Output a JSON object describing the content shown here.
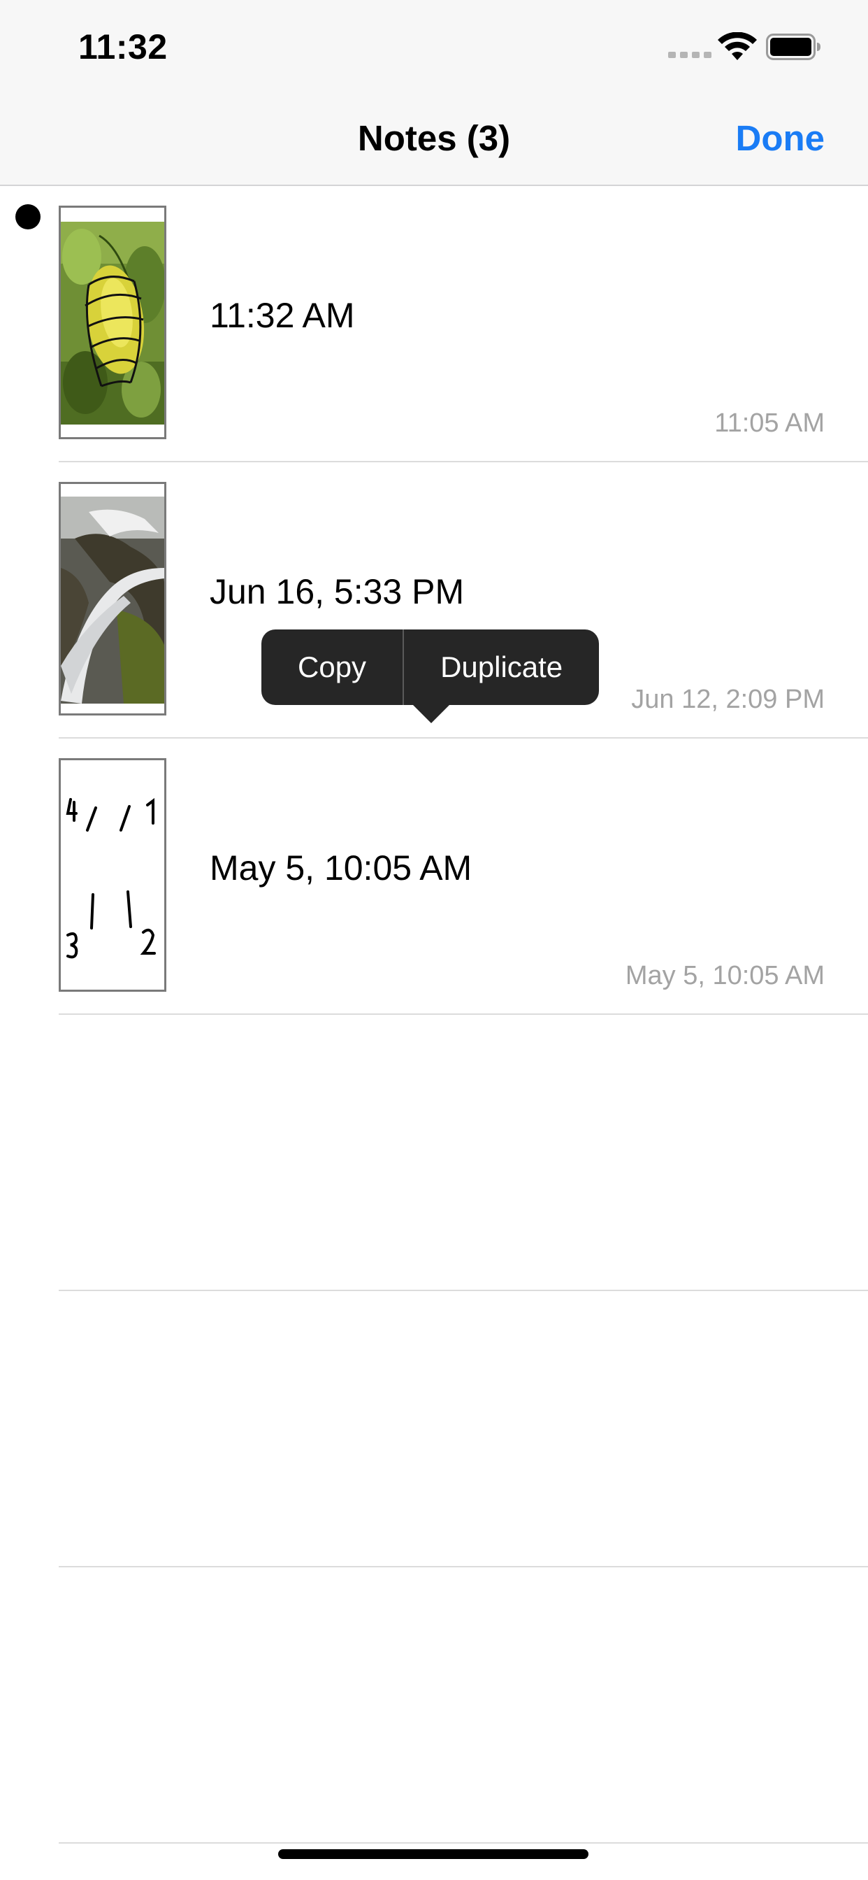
{
  "status_bar": {
    "time": "11:32"
  },
  "nav": {
    "title": "Notes (3)",
    "done_label": "Done"
  },
  "notes": [
    {
      "title": "11:32 AM",
      "date": "11:05 AM",
      "thumbnail": "leaf-photo-with-drawing",
      "selected": true
    },
    {
      "title": "Jun 16, 5:33 PM",
      "date": "Jun 12, 2:09 PM",
      "thumbnail": "waterfall-photo",
      "selected": false
    },
    {
      "title": "May 5, 10:05 AM",
      "date": "May 5, 10:05 AM",
      "thumbnail": "handwritten-marks-sketch",
      "selected": false
    }
  ],
  "context_menu": {
    "copy_label": "Copy",
    "duplicate_label": "Duplicate"
  },
  "colors": {
    "accent": "#1a7cf5",
    "menu_background": "#262626",
    "date_text": "#a3a3a3",
    "separator": "#dcdcdc"
  }
}
